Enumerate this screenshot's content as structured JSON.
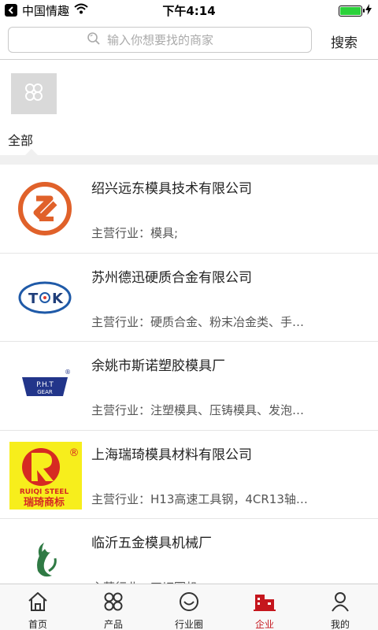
{
  "status_bar": {
    "carrier": "中国情趣",
    "time": "下午4:14",
    "battery_level": 1.0
  },
  "search": {
    "placeholder": "输入你想要找的商家",
    "button_label": "搜索"
  },
  "categories": {
    "items": [
      {
        "label": "全部",
        "icon": "grid-icon",
        "active": true
      }
    ]
  },
  "companies": [
    {
      "name": "绍兴远东模具技术有限公司",
      "industry": "主营行业：模具;",
      "logo": "yuandong-logo"
    },
    {
      "name": "苏州德迅硬质合金有限公司",
      "industry": "主营行业：硬质合金、粉末冶金类、手…",
      "logo": "tk-logo",
      "logo_text": "T",
      "logo_text2": "K"
    },
    {
      "name": "余姚市斯诺塑胶模具厂",
      "industry": "主营行业：注塑模具、压铸模具、发泡…",
      "logo": "pht-gear-logo",
      "logo_text": "P.H.T",
      "logo_text2": "GEAR",
      "logo_mark": "®"
    },
    {
      "name": "上海瑞琦模具材料有限公司",
      "industry": "主营行业：H13高速工具钢，4CR13轴…",
      "logo": "ruiqi-logo",
      "logo_text": "RUIQI STEEL",
      "logo_text2": "瑞琦商标",
      "logo_mark": "®"
    },
    {
      "name": "临沂五金模具机械厂",
      "industry": "主营行业：刀切圆机",
      "logo": "linyi-leaf-logo"
    }
  ],
  "tab_bar": {
    "tabs": [
      {
        "label": "首页",
        "icon": "home-icon"
      },
      {
        "label": "产品",
        "icon": "grid-icon"
      },
      {
        "label": "行业圈",
        "icon": "smile-icon"
      },
      {
        "label": "企业",
        "icon": "building-icon",
        "active": true
      },
      {
        "label": "我的",
        "icon": "user-icon"
      }
    ]
  },
  "colors": {
    "accent": "#c5161d",
    "battery": "#2bd13a",
    "band": "#f0f0f0"
  }
}
